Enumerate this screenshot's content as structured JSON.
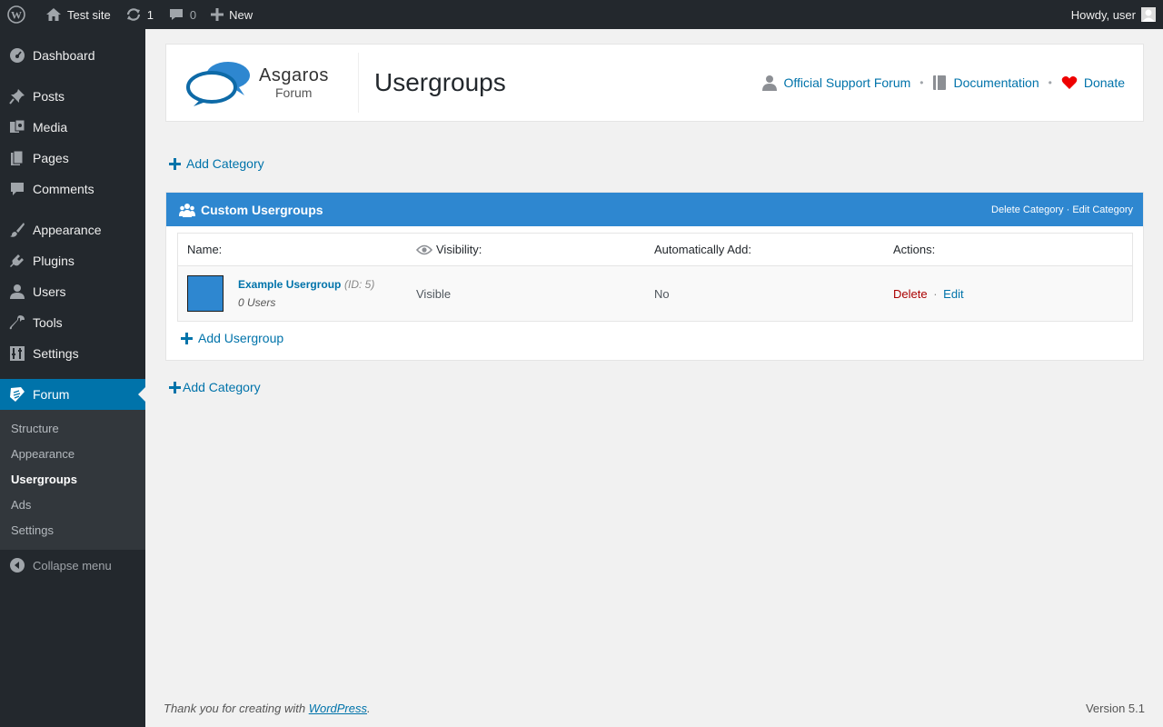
{
  "adminbar": {
    "site_name": "Test site",
    "updates_count": "1",
    "comments_count": "0",
    "new_label": "New",
    "greeting": "Howdy, user"
  },
  "sidebar": {
    "items": [
      {
        "label": "Dashboard"
      },
      {
        "label": "Posts"
      },
      {
        "label": "Media"
      },
      {
        "label": "Pages"
      },
      {
        "label": "Comments"
      },
      {
        "label": "Appearance"
      },
      {
        "label": "Plugins"
      },
      {
        "label": "Users"
      },
      {
        "label": "Tools"
      },
      {
        "label": "Settings"
      },
      {
        "label": "Forum"
      }
    ],
    "submenu": [
      {
        "label": "Structure"
      },
      {
        "label": "Appearance"
      },
      {
        "label": "Usergroups"
      },
      {
        "label": "Ads"
      },
      {
        "label": "Settings"
      }
    ],
    "collapse_label": "Collapse menu",
    "accent": "#0073aa"
  },
  "header": {
    "logo_line1": "Asgaros",
    "logo_line2": "Forum",
    "title": "Usergroups",
    "links": [
      {
        "label": "Official Support Forum"
      },
      {
        "label": "Documentation"
      },
      {
        "label": "Donate"
      }
    ],
    "separator": "•"
  },
  "main": {
    "add_category_label": "Add Category",
    "category": {
      "title": "Custom Usergroups",
      "delete_label": "Delete Category",
      "separator": "·",
      "edit_label": "Edit Category",
      "header_color": "#2e87d0",
      "columns": [
        "Name:",
        "Visibility:",
        "Automatically Add:",
        "Actions:"
      ],
      "usergroups": [
        {
          "name": "Example Usergroup",
          "id_text": "(ID: 5)",
          "users": "0 Users",
          "visibility": "Visible",
          "auto_add": "No",
          "delete_label": "Delete",
          "separator": "·",
          "edit_label": "Edit",
          "color": "#2e87d0"
        }
      ],
      "add_usergroup_label": "Add Usergroup"
    }
  },
  "footer": {
    "thanks_prefix": "Thank you for creating with ",
    "thanks_link": "WordPress",
    "thanks_suffix": ".",
    "version": "Version 5.1"
  }
}
